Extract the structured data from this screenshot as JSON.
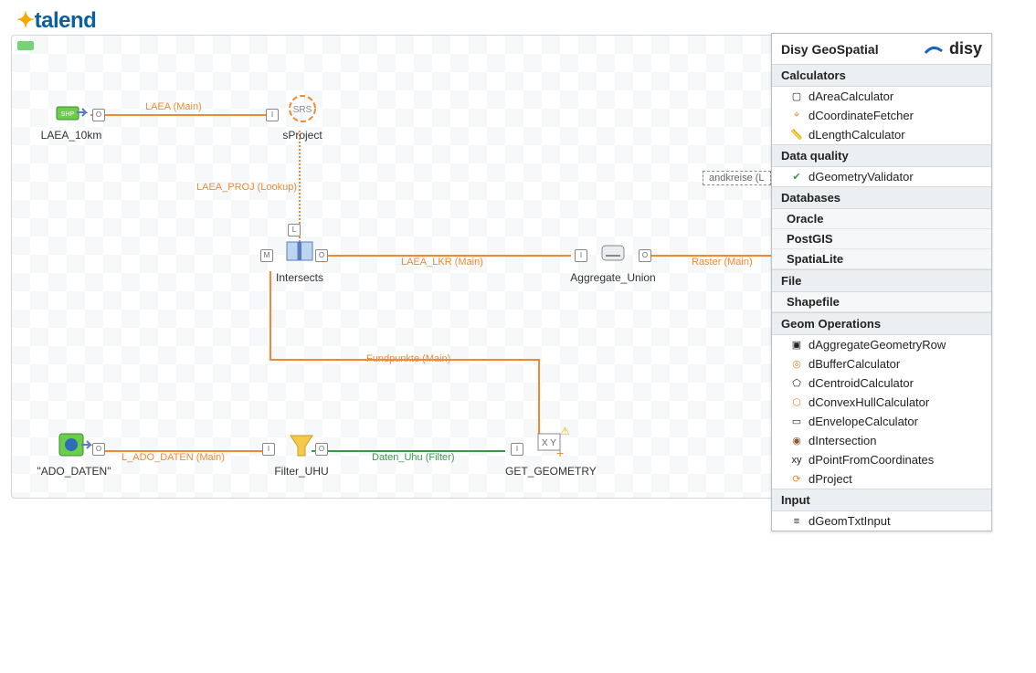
{
  "brand": {
    "talend": "talend",
    "disy": "disy"
  },
  "canvas": {
    "tag": "andkreise (L",
    "nodes": {
      "laea10km": "LAEA_10km",
      "sproject": "sProject",
      "intersects": "Intersects",
      "aggregate": "Aggregate_Union",
      "ado_daten": "\"ADO_DATEN\"",
      "filter_uhu": "Filter_UHU",
      "get_geometry": "GET_GEOMETRY"
    },
    "links": {
      "laea_main": "LAEA (Main)",
      "laea_proj": "LAEA_PROJ (Lookup)",
      "laea_lkr": "LAEA_LKR (Main)",
      "raster": "Raster (Main)",
      "fundpunkte": "Fundpunkte (Main)",
      "l_ado": "L_ADO_DATEN (Main)",
      "daten_uhu": "Daten_Uhu (Filter)"
    }
  },
  "palette": {
    "title": "Disy GeoSpatial",
    "groups": {
      "calculators": {
        "label": "Calculators",
        "items": {
          "area": "dAreaCalculator",
          "coord": "dCoordinateFetcher",
          "length": "dLengthCalculator"
        }
      },
      "dataquality": {
        "label": "Data quality",
        "items": {
          "validator": "dGeometryValidator"
        }
      },
      "databases": {
        "label": "Databases",
        "items": {
          "oracle": "Oracle",
          "postgis": "PostGIS",
          "spatialite": "SpatiaLite"
        }
      },
      "file": {
        "label": "File",
        "items": {
          "shapefile": "Shapefile"
        }
      },
      "geomops": {
        "label": "Geom Operations",
        "items": {
          "agg": "dAggregateGeometryRow",
          "buffer": "dBufferCalculator",
          "centroid": "dCentroidCalculator",
          "convex": "dConvexHullCalculator",
          "envelope": "dEnvelopeCalculator",
          "intersection": "dIntersection",
          "pointcoord": "dPointFromCoordinates",
          "project": "dProject"
        }
      },
      "input": {
        "label": "Input",
        "items": {
          "geomtxt": "dGeomTxtInput"
        }
      }
    }
  }
}
